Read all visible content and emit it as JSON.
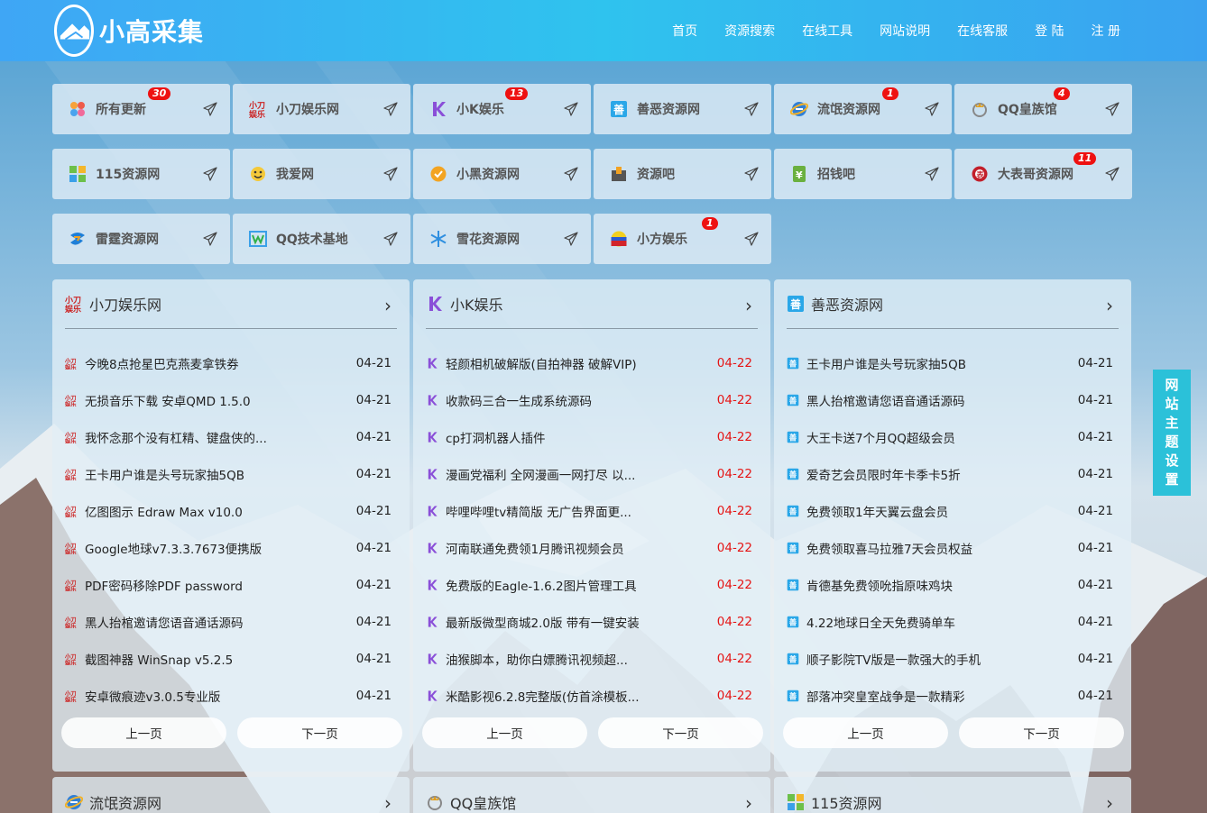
{
  "brand": {
    "name": "小高采集"
  },
  "nav": [
    "首页",
    "资源搜索",
    "在线工具",
    "网站说明",
    "在线客服",
    "登 陆",
    "注 册"
  ],
  "colors": {
    "header": "#2fc3ee",
    "badge": "#e11111",
    "date_red": "#e51515",
    "theme_tab": "#2bc1d9"
  },
  "tiles": [
    {
      "label": "所有更新",
      "icon": "flower-grid-icon",
      "badge": "30"
    },
    {
      "label": "小刀娱乐网",
      "icon": "xd-logo-icon",
      "badge": ""
    },
    {
      "label": "小K娱乐",
      "icon": "k-logo-icon",
      "badge": "13"
    },
    {
      "label": "善恶资源网",
      "icon": "se-logo-icon",
      "badge": ""
    },
    {
      "label": "流氓资源网",
      "icon": "ie-logo-icon",
      "badge": "1"
    },
    {
      "label": "QQ皇族馆",
      "icon": "qq-crown-icon",
      "badge": "4"
    },
    {
      "label": "115资源网",
      "icon": "grid-icon",
      "badge": ""
    },
    {
      "label": "我爱网",
      "icon": "smile-icon",
      "badge": ""
    },
    {
      "label": "小黑资源网",
      "icon": "check-badge-icon",
      "badge": ""
    },
    {
      "label": "资源吧",
      "icon": "box-icon",
      "badge": ""
    },
    {
      "label": "招钱吧",
      "icon": "money-icon",
      "badge": ""
    },
    {
      "label": "大表哥资源网",
      "icon": "dbg-logo-icon",
      "badge": "11"
    },
    {
      "label": "雷霆资源网",
      "icon": "thunder-icon",
      "badge": ""
    },
    {
      "label": "QQ技术基地",
      "icon": "w-logo-icon",
      "badge": ""
    },
    {
      "label": "雪花资源网",
      "icon": "snowflake-icon",
      "badge": ""
    },
    {
      "label": "小方娱乐",
      "icon": "flag-ball-icon",
      "badge": "1"
    }
  ],
  "panels": [
    {
      "title": "小刀娱乐网",
      "icon": "xd-logo-icon",
      "items": [
        {
          "t": "今晚8点抢星巴克燕麦拿铁券",
          "d": "04-21",
          "red": false
        },
        {
          "t": "无损音乐下载 安卓QMD 1.5.0",
          "d": "04-21",
          "red": false
        },
        {
          "t": "我怀念那个没有杠精、键盘侠的...",
          "d": "04-21",
          "red": false
        },
        {
          "t": "王卡用户谁是头号玩家抽5QB",
          "d": "04-21",
          "red": false
        },
        {
          "t": "亿图图示 Edraw Max v10.0",
          "d": "04-21",
          "red": false
        },
        {
          "t": "Google地球v7.3.3.7673便携版",
          "d": "04-21",
          "red": false
        },
        {
          "t": "PDF密码移除PDF password",
          "d": "04-21",
          "red": false
        },
        {
          "t": "黑人抬棺邀请您语音通话源码",
          "d": "04-21",
          "red": false
        },
        {
          "t": "截图神器 WinSnap v5.2.5",
          "d": "04-21",
          "red": false
        },
        {
          "t": "安卓微痕迹v3.0.5专业版",
          "d": "04-21",
          "red": false
        }
      ]
    },
    {
      "title": "小K娱乐",
      "icon": "k-logo-icon",
      "items": [
        {
          "t": "轻颜相机破解版(自拍神器 破解VIP)",
          "d": "04-22",
          "red": true
        },
        {
          "t": "收款码三合一生成系统源码",
          "d": "04-22",
          "red": true
        },
        {
          "t": "cp打洞机器人插件",
          "d": "04-22",
          "red": true
        },
        {
          "t": "漫画党福利 全网漫画一网打尽 以...",
          "d": "04-22",
          "red": true
        },
        {
          "t": "哔哩哔哩tv精简版 无广告界面更...",
          "d": "04-22",
          "red": true
        },
        {
          "t": "河南联通免费领1月腾讯视频会员",
          "d": "04-22",
          "red": true
        },
        {
          "t": "免费版的Eagle-1.6.2图片管理工具",
          "d": "04-22",
          "red": true
        },
        {
          "t": "最新版微型商城2.0版 带有一键安装",
          "d": "04-22",
          "red": true
        },
        {
          "t": "油猴脚本，助你白嫖腾讯视频超...",
          "d": "04-22",
          "red": true
        },
        {
          "t": "米酷影视6.2.8完整版(仿首涂模板...",
          "d": "04-22",
          "red": true
        }
      ]
    },
    {
      "title": "善恶资源网",
      "icon": "se-logo-icon",
      "items": [
        {
          "t": "王卡用户谁是头号玩家抽5QB",
          "d": "04-21",
          "red": false
        },
        {
          "t": "黑人抬棺邀请您语音通话源码",
          "d": "04-21",
          "red": false
        },
        {
          "t": "大王卡送7个月QQ超级会员",
          "d": "04-21",
          "red": false
        },
        {
          "t": "爱奇艺会员限时年卡季卡5折",
          "d": "04-21",
          "red": false
        },
        {
          "t": "免费领取1年天翼云盘会员",
          "d": "04-21",
          "red": false
        },
        {
          "t": "免费领取喜马拉雅7天会员权益",
          "d": "04-21",
          "red": false
        },
        {
          "t": "肯德基免费领吮指原味鸡块",
          "d": "04-21",
          "red": false
        },
        {
          "t": "4.22地球日全天免费骑单车",
          "d": "04-21",
          "red": false
        },
        {
          "t": "顺子影院TV版是一款强大的手机",
          "d": "04-21",
          "red": false
        },
        {
          "t": "部落冲突皇室战争是一款精彩",
          "d": "04-21",
          "red": false
        }
      ]
    }
  ],
  "pager": {
    "prev": "上一页",
    "next": "下一页"
  },
  "bottom_panels": [
    {
      "title": "流氓资源网",
      "icon": "ie-logo-icon"
    },
    {
      "title": "QQ皇族馆",
      "icon": "qq-crown-icon"
    },
    {
      "title": "115资源网",
      "icon": "grid-icon"
    }
  ],
  "theme_tab": [
    "网",
    "站",
    "主",
    "题",
    "设",
    "置"
  ]
}
